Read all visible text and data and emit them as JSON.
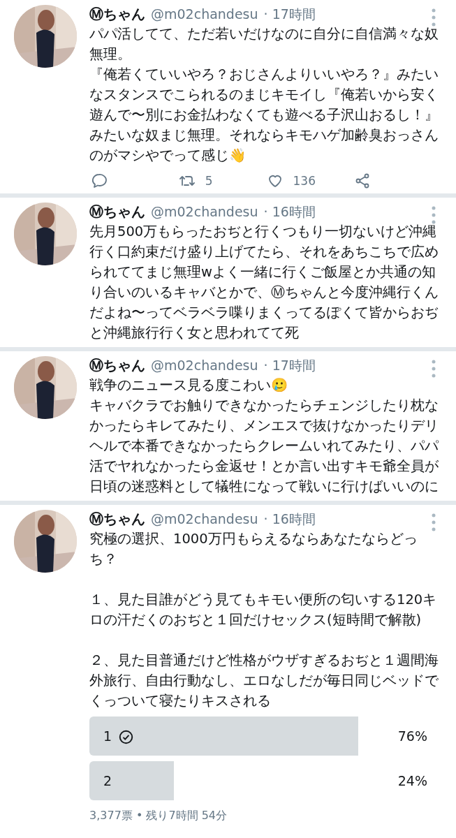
{
  "tweets": [
    {
      "name": "Ⓜちゃん",
      "handle": "@m02chandesu",
      "time": "· 17時間",
      "paragraphs": [
        "パパ活してて、ただ若いだけなのに自分に自信満々な奴無理。",
        "『俺若くていいやろ？おじさんよりいいやろ？』みたいなスタンスでこられるのまじキモイし『俺若いから安く遊んで〜別にお金払わなくても遊べる子沢山おるし！』みたいな奴まじ無理。それならキモハゲ加齢臭おっさんのがマシやでって感じ👋"
      ],
      "actions": {
        "retweets": "5",
        "likes": "136"
      }
    },
    {
      "name": "Ⓜちゃん",
      "handle": "@m02chandesu",
      "time": "· 16時間",
      "paragraphs": [
        "先月500万もらったおぢと行くつもり一切ないけど沖縄行く口約束だけ盛り上げてたら、それをあちこちで広められててまじ無理wよく一緒に行くご飯屋とか共通の知り合いのいるキャバとかで、Ⓜちゃんと今度沖縄行くんだよね〜ってベラベラ喋りまくってるぽくて皆からおぢと沖縄旅行行く女と思われてて死"
      ]
    },
    {
      "name": "Ⓜちゃん",
      "handle": "@m02chandesu",
      "time": "· 17時間",
      "paragraphs": [
        "戦争のニュース見る度こわい🥲",
        "キャバクラでお触りできなかったらチェンジしたり枕なかったらキレてみたり、メンエスで抜けなかったりデリヘルで本番できなかったらクレームいれてみたり、パパ活でヤれなかったら金返せ！とか言い出すキモ爺全員が日頃の迷惑料として犠牲になって戦いに行けばいいのに"
      ]
    },
    {
      "name": "Ⓜちゃん",
      "handle": "@m02chandesu",
      "time": "· 16時間",
      "paragraphs": [
        "究極の選択、1000万円もらえるならあなたならどっち？",
        "１、見た目誰がどう見てもキモい便所の匂いする120キロの汗だくのおぢと１回だけセックス(短時間で解散)",
        "２、見た目普通だけど性格がウザすぎるおぢと１週間海外旅行、自由行動なし、エロなしだが毎日同じベッドでくっついて寝たりキスされる"
      ],
      "poll": {
        "options": [
          {
            "label": "1",
            "percent": "76%",
            "level": 0.76,
            "selected": true
          },
          {
            "label": "2",
            "percent": "24%",
            "level": 0.24,
            "selected": false
          }
        ],
        "footer": "3,377票 • 残り7時間 54分"
      }
    }
  ]
}
